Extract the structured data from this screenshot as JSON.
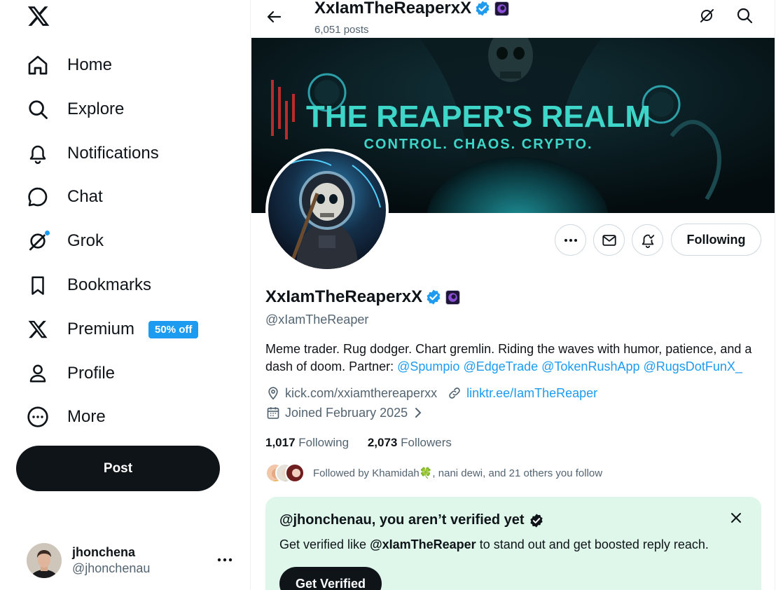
{
  "nav": {
    "items": [
      {
        "label": "Home"
      },
      {
        "label": "Explore"
      },
      {
        "label": "Notifications"
      },
      {
        "label": "Chat"
      },
      {
        "label": "Grok"
      },
      {
        "label": "Bookmarks"
      },
      {
        "label": "Premium",
        "badge": "50% off"
      },
      {
        "label": "Profile"
      },
      {
        "label": "More"
      }
    ],
    "post_label": "Post"
  },
  "account": {
    "name": "jhonchena",
    "handle": "@jhonchenau"
  },
  "header": {
    "title": "XxIamTheReaperxX",
    "posts": "6,051 posts"
  },
  "banner": {
    "title": "THE REAPER'S REALM",
    "subtitle": "CONTROL. CHAOS. CRYPTO."
  },
  "profile": {
    "name": "XxIamTheReaperxX",
    "handle": "@xIamTheReaper",
    "bio_text": "Meme trader. Rug dodger. Chart gremlin. Riding the waves with humor, patience, and a dash of doom. Partner: ",
    "bio_links": [
      "@Spumpio",
      "@EdgeTrade",
      "@TokenRushApp",
      "@RugsDotFunX_"
    ],
    "location": "kick.com/xxiamthereaperxx",
    "website": "linktr.ee/IamTheReaper",
    "joined": "Joined February 2025",
    "following_count": "1,017",
    "following_label": "Following",
    "followers_count": "2,073",
    "followers_label": "Followers",
    "followed_by": "Followed by Khamidah🍀, nani dewi, and 21 others you follow",
    "following_button": "Following"
  },
  "verify_card": {
    "title": "@jhonchenau, you aren’t verified yet",
    "text_prefix": "Get verified like ",
    "text_handle": "@xIamTheReaper",
    "text_suffix": " to stand out and get boosted reply reach.",
    "button": "Get Verified"
  },
  "colors": {
    "accent": "#1d9bf0",
    "card_bg": "#def7ea",
    "banner_text": "#3ed6c8"
  }
}
